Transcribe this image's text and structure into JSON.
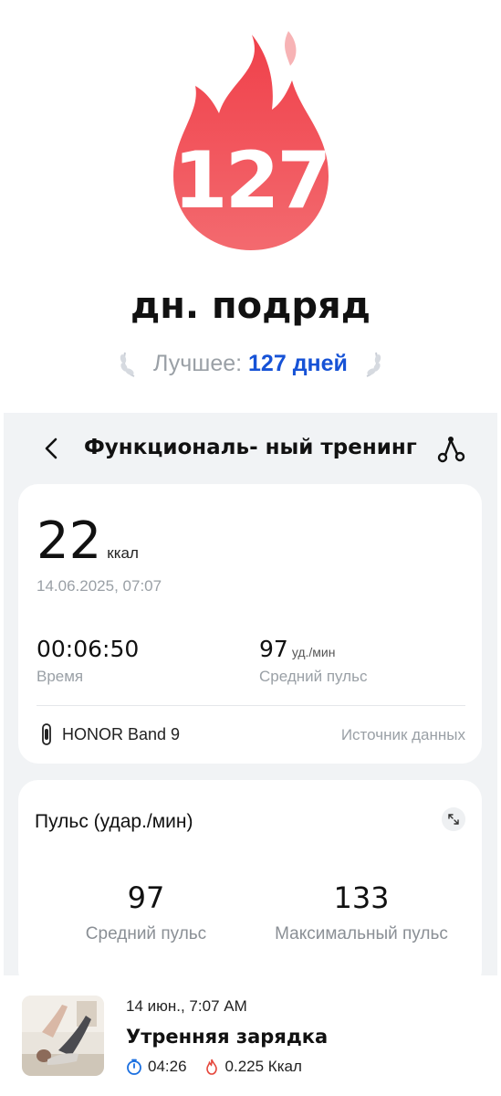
{
  "streak": {
    "count": "127",
    "label": "дн. подряд",
    "best_label": "Лучшее:",
    "best_value": "127 дней",
    "flame_color": "#f0474f"
  },
  "header": {
    "back_icon": "chevron-left-icon",
    "title": "Функциональ- ный тренинг",
    "route_icon": "route-icon"
  },
  "summary": {
    "kcal_value": "22",
    "kcal_unit": "ккал",
    "date": "14.06.2025, 07:07",
    "time_value": "00:06:50",
    "time_label": "Время",
    "pulse_value": "97",
    "pulse_unit": "уд./мин",
    "pulse_label": "Средний пульс",
    "device": "HONOR Band 9",
    "source_label": "Источник данных"
  },
  "pulse_card": {
    "title": "Пульс (удар./мин)",
    "avg_value": "97",
    "avg_label": "Средний пульс",
    "max_value": "133",
    "max_label": "Максимальный пульс",
    "expand_icon": "expand-icon"
  },
  "activity": {
    "date": "14 июн., 7:07 AM",
    "title": "Утренняя зарядка",
    "duration": "04:26",
    "calories": "0.225 Ккал",
    "accent_blue": "#1a6fe0",
    "accent_red": "#e5483d"
  }
}
